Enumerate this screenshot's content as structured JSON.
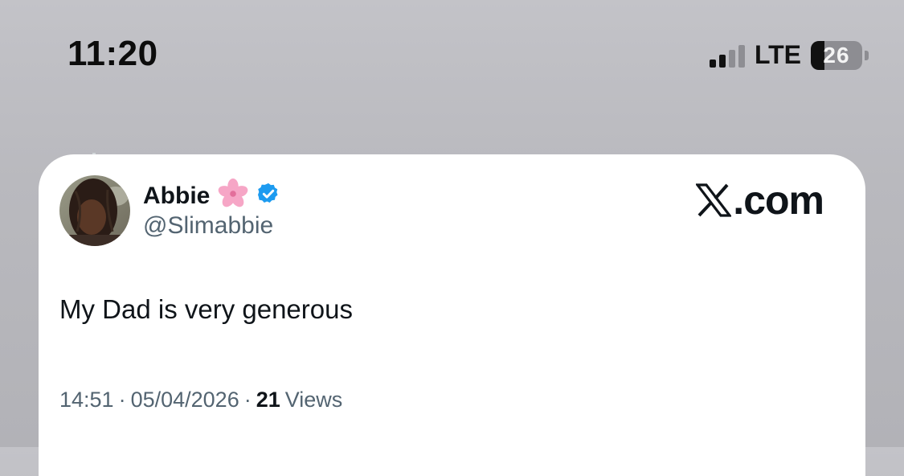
{
  "status_bar": {
    "time": "11:20",
    "network": "LTE",
    "battery_level": "26",
    "battery_fraction": 0.26,
    "signal_bars_active": 2,
    "signal_bars_total": 4
  },
  "tweet": {
    "display_name": "Abbie",
    "name_emoji": "cherry-blossom-icon",
    "verified": true,
    "handle": "@Slimabbie",
    "text": "My Dad is very generous",
    "time": "14:51",
    "separator": "·",
    "date": "05/04/2026",
    "views_count": "21",
    "views_label": "Views"
  },
  "brand": {
    "text": ".com"
  },
  "colors": {
    "verified_badge": "#1d9bf0",
    "secondary_text": "#536471",
    "primary_text": "#0f1419",
    "blossom": "#f6a6c6"
  }
}
